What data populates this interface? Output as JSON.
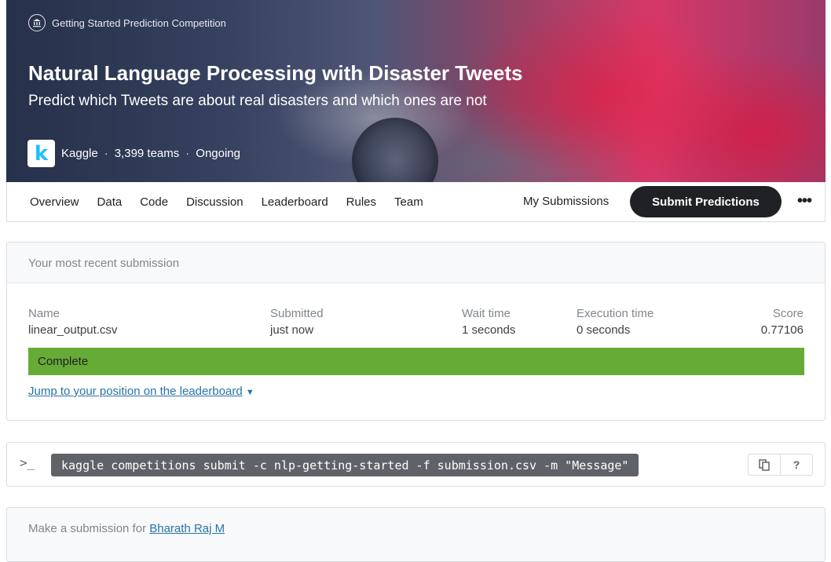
{
  "banner": {
    "competition_type": "Getting Started Prediction Competition",
    "competition_type_icon": "bank-icon",
    "title": "Natural Language Processing with Disaster Tweets",
    "subtitle": "Predict which Tweets are about real disasters and which ones are not",
    "host": "Kaggle",
    "host_logo": "k",
    "teams": "3,399 teams",
    "status": "Ongoing",
    "separator": "·"
  },
  "nav": {
    "tabs": [
      "Overview",
      "Data",
      "Code",
      "Discussion",
      "Leaderboard",
      "Rules",
      "Team"
    ],
    "my_submissions": "My Submissions",
    "submit_button": "Submit Predictions",
    "more_icon": "•••"
  },
  "submission": {
    "header": "Your most recent submission",
    "columns": {
      "name": {
        "label": "Name",
        "value": "linear_output.csv"
      },
      "submitted": {
        "label": "Submitted",
        "value": "just now"
      },
      "wait": {
        "label": "Wait time",
        "value": "1 seconds"
      },
      "execution": {
        "label": "Execution time",
        "value": "0 seconds"
      },
      "score": {
        "label": "Score",
        "value": "0.77106"
      }
    },
    "status": "Complete",
    "status_color": "#66ab35",
    "jump_link": "Jump to your position on the leaderboard"
  },
  "cli": {
    "prompt_icon": ">_",
    "command": "kaggle competitions submit -c nlp-getting-started -f submission.csv -m \"Message\"",
    "copy_icon": "copy-icon",
    "help_label": "?"
  },
  "make_submission": {
    "text": "Make a submission for",
    "user": "Bharath Raj M"
  }
}
